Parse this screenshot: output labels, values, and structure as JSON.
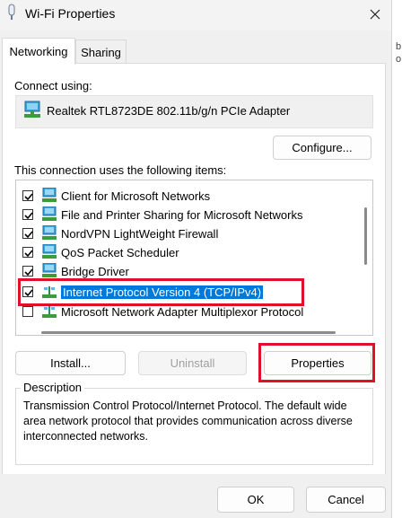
{
  "window": {
    "title": "Wi-Fi Properties"
  },
  "tabs": [
    {
      "label": "Networking"
    },
    {
      "label": "Sharing"
    }
  ],
  "connect_using": {
    "label": "Connect using:",
    "adapter": "Realtek RTL8723DE 802.11b/g/n PCIe Adapter"
  },
  "configure_label": "Configure...",
  "items_label": "This connection uses the following items:",
  "items": [
    {
      "label": "Client for Microsoft Networks",
      "checked": true,
      "icon": "network-client-icon"
    },
    {
      "label": "File and Printer Sharing for Microsoft Networks",
      "checked": true,
      "icon": "network-service-icon"
    },
    {
      "label": "NordVPN LightWeight Firewall",
      "checked": true,
      "icon": "network-service-icon"
    },
    {
      "label": "QoS Packet Scheduler",
      "checked": true,
      "icon": "network-service-icon"
    },
    {
      "label": "Bridge Driver",
      "checked": true,
      "icon": "network-service-icon"
    },
    {
      "label": "Internet Protocol Version 4 (TCP/IPv4)",
      "checked": true,
      "selected": true,
      "icon": "network-protocol-icon"
    },
    {
      "label": "Microsoft Network Adapter Multiplexor Protocol",
      "checked": false,
      "icon": "network-protocol-icon"
    }
  ],
  "buttons": {
    "install": "Install...",
    "uninstall": "Uninstall",
    "properties": "Properties",
    "ok": "OK",
    "cancel": "Cancel"
  },
  "description": {
    "label": "Description",
    "text": "Transmission Control Protocol/Internet Protocol. The default wide area network protocol that provides communication across diverse interconnected networks."
  },
  "background_window": {
    "glyph_1": "b",
    "glyph_2": "o"
  },
  "colors": {
    "selection": "#0078d7",
    "highlight_border": "#e0102b",
    "dialog_bg": "#f0f0f0"
  }
}
